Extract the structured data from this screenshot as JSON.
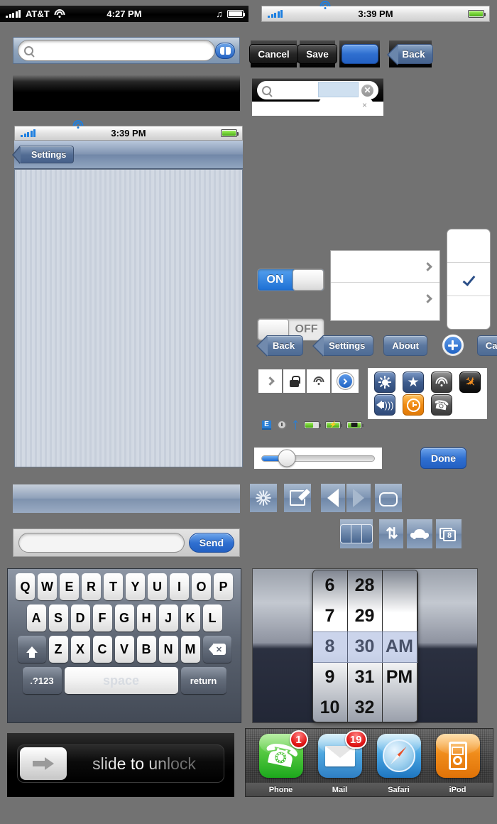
{
  "left_panel": {
    "status_bar": {
      "carrier": "AT&T",
      "time": "4:27 PM",
      "signal_icon": "signal-bars-icon",
      "wifi_icon": "wifi-icon",
      "music_icon": "music-note-icon",
      "battery_icon": "battery-icon"
    },
    "search_bar": {
      "placeholder": "",
      "search_icon": "search-icon",
      "bookmarks_icon": "bookmarks-book-icon"
    },
    "nav_status_bar": {
      "time": "3:39 PM"
    },
    "nav_bar": {
      "back_label": "Settings",
      "title": ""
    },
    "message_bar": {
      "placeholder": "",
      "send_label": "Send"
    },
    "keyboard": {
      "row1": [
        "Q",
        "W",
        "E",
        "R",
        "T",
        "Y",
        "U",
        "I",
        "O",
        "P"
      ],
      "row2": [
        "A",
        "S",
        "D",
        "F",
        "G",
        "H",
        "J",
        "K",
        "L"
      ],
      "row3": [
        "Z",
        "X",
        "C",
        "V",
        "B",
        "N",
        "M"
      ],
      "shift_icon": "shift-arrow-icon",
      "delete_icon": "delete-backspace-icon",
      "numeric_label": ".?123",
      "space_label": "space",
      "return_label": "return"
    },
    "lock_screen": {
      "slide_text": "slide to unlock",
      "arrow_icon": "right-arrow-icon"
    }
  },
  "right_panel": {
    "status_bar": {
      "time": "3:39 PM"
    },
    "toolbar_buttons": {
      "cancel": "Cancel",
      "save": "Save",
      "plain_blue": "",
      "back": "Back"
    },
    "search_field": {
      "placeholder": "",
      "clear_icon": "clear-circle-x-icon",
      "small_clear": "×"
    },
    "switches": [
      {
        "label": "ON",
        "state": "on"
      },
      {
        "label": "OFF",
        "state": "off"
      }
    ],
    "list_rows": [
      {
        "label": "",
        "accessory": "disclosure-chevron"
      },
      {
        "label": "",
        "accessory": "disclosure-chevron"
      }
    ],
    "check_rows": [
      {
        "label": "",
        "checked": false
      },
      {
        "label": "",
        "checked": true
      },
      {
        "label": "",
        "checked": false
      }
    ],
    "nav_buttons": [
      {
        "label": "Back",
        "style": "arrow"
      },
      {
        "label": "Settings",
        "style": "arrow"
      },
      {
        "label": "About",
        "style": "plain"
      },
      {
        "label": "",
        "style": "plus-icon"
      },
      {
        "label": "Cancel",
        "style": "plain"
      }
    ],
    "accessory_icons": [
      "disclosure-chevron-icon",
      "lock-icon",
      "wifi-icon",
      "blue-arrow-circle-icon"
    ],
    "settings_icons": [
      "brightness-sun-icon",
      "star-icon",
      "wifi-icon",
      "airplane-mode-icon",
      "volume-speaker-icon",
      "clock-icon",
      "phone-icon"
    ],
    "status_mini_icons": [
      "edge-e-icon",
      "alarm-clock-icon",
      "bluetooth-icon",
      "battery-partial-icon",
      "battery-charging-icon",
      "battery-plugged-icon"
    ],
    "slider": {
      "value": 22
    },
    "done_label": "Done",
    "toolbar_icons": [
      "activity-spinner-icon",
      "compose-icon",
      "previous-triangle-icon",
      "next-triangle-icon",
      "bookmarks-book-icon"
    ],
    "tab_icons": [
      "segmented-control-icon",
      "up-down-arrows-icon",
      "car-icon",
      "pages-badge-icon"
    ],
    "pages_badge": "8",
    "picker": {
      "hours": [
        "6",
        "7",
        "8",
        "9",
        "10"
      ],
      "minutes": [
        "28",
        "29",
        "30",
        "31",
        "32"
      ],
      "meridiem": [
        "",
        "",
        "AM",
        "PM",
        ""
      ],
      "selected_hour": "8",
      "selected_minute": "30",
      "selected_meridiem": "AM"
    },
    "dock": [
      {
        "label": "Phone",
        "badge": "1",
        "icon": "phone-app-icon"
      },
      {
        "label": "Mail",
        "badge": "19",
        "icon": "mail-app-icon"
      },
      {
        "label": "Safari",
        "badge": "",
        "icon": "safari-app-icon"
      },
      {
        "label": "iPod",
        "badge": "",
        "icon": "ipod-app-icon"
      }
    ]
  },
  "colors": {
    "background": "#727272",
    "accent_blue": "#2f6fd0",
    "nav_blue": "#5b779f",
    "badge_red": "#e01515",
    "switch_on": "#1c6fd4"
  }
}
